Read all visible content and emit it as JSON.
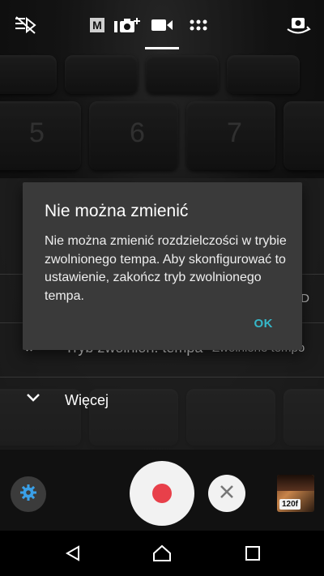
{
  "topbar": {
    "icons": [
      "flash-off-icon",
      "manual-mode-icon",
      "photo-plus-icon",
      "video-icon",
      "more-modes-icon",
      "switch-camera-icon"
    ],
    "manual_label": "M"
  },
  "sheet": {
    "row_fps_value": "D",
    "row_slowmo_label": "Tryb zwolnion. tempa",
    "row_slowmo_value": "Zwolnione tempo",
    "more_label": "Więcej"
  },
  "dialog": {
    "title": "Nie można zmienić",
    "message": "Nie można zmienić rozdzielczości w trybie zwolnionego tempa. Aby skonfigurować to ustawienie, zakończ tryb zwolnionego tempa.",
    "ok_label": "OK"
  },
  "controls": {
    "thumbnail_badge": "120f"
  },
  "colors": {
    "accent_ok": "#35b7c9",
    "record": "#e8404a",
    "settings_icon": "#3aa0e8"
  }
}
